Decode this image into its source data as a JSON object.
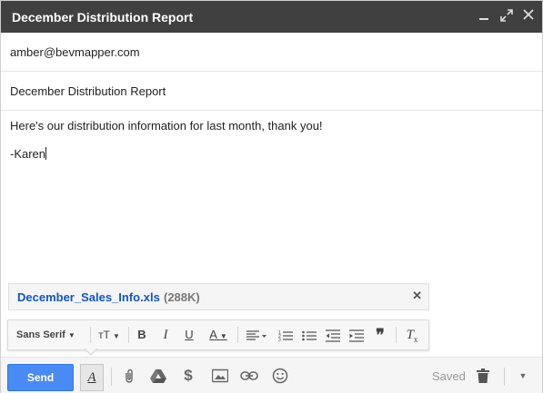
{
  "window": {
    "title": "December Distribution Report",
    "controls": [
      "minimize-icon",
      "expand-icon",
      "close-icon"
    ]
  },
  "to": {
    "value": "amber@bevmapper.com"
  },
  "subject": {
    "value": "December Distribution Report"
  },
  "body": {
    "lines": [
      "Here's our distribution information for last month, thank you!",
      "-Karen"
    ]
  },
  "attachment": {
    "filename": "December_Sales_Info.xls",
    "size": "(288K)"
  },
  "formatting_toolbar": {
    "font": "Sans Serif",
    "buttons": [
      "font-size-icon",
      "bold-icon",
      "italic-icon",
      "underline-icon",
      "text-color-icon",
      "align-icon",
      "numbered-list-icon",
      "bulleted-list-icon",
      "indent-less-icon",
      "indent-more-icon",
      "quote-icon",
      "clear-format-icon"
    ]
  },
  "bottom_bar": {
    "send_label": "Send",
    "status": "Saved",
    "icons": [
      "formatting-options-icon",
      "attach-file-icon",
      "drive-icon",
      "money-icon",
      "insert-photo-icon",
      "insert-link-icon",
      "emoji-icon",
      "discard-icon",
      "more-options-icon"
    ]
  },
  "colors": {
    "titlebar": "#404040",
    "send_button": "#4a8af4",
    "attachment_link": "#1155cc"
  }
}
